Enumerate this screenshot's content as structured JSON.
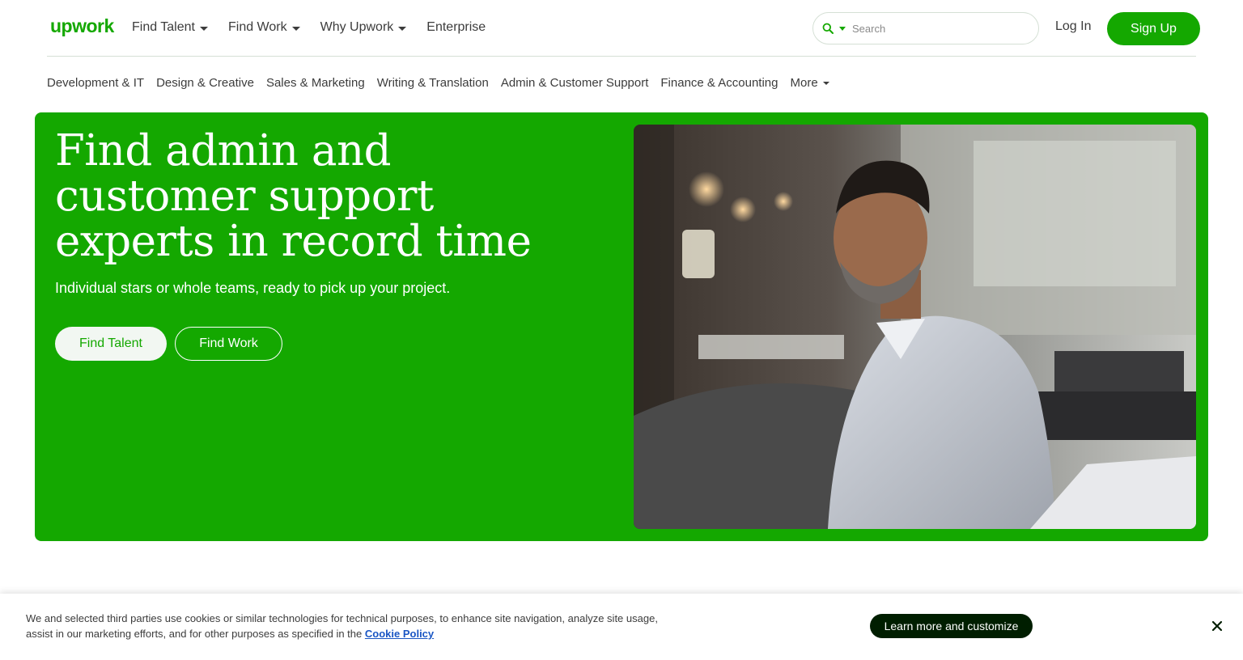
{
  "brand": {
    "logo_text": "upwork",
    "accent": "#14a800",
    "dark": "#001e00"
  },
  "header": {
    "nav": [
      {
        "label": "Find Talent",
        "has_caret": true
      },
      {
        "label": "Find Work",
        "has_caret": true
      },
      {
        "label": "Why Upwork",
        "has_caret": true
      },
      {
        "label": "Enterprise",
        "has_caret": false
      }
    ],
    "search": {
      "placeholder": "Search",
      "icon": "search-icon"
    },
    "login_label": "Log In",
    "signup_label": "Sign Up"
  },
  "categories": [
    "Development & IT",
    "Design & Creative",
    "Sales & Marketing",
    "Writing & Translation",
    "Admin & Customer Support",
    "Finance & Accounting",
    "More"
  ],
  "hero": {
    "title": "Find admin and customer support experts in record time",
    "subtitle": "Individual stars or whole teams, ready to pick up your project.",
    "primary_button": "Find Talent",
    "secondary_button": "Find Work",
    "photo": "man-working-at-laptop-in-office"
  },
  "cookie_banner": {
    "text": "We and selected third parties use cookies or similar technologies for technical purposes, to enhance site navigation, analyze site usage, assist in our marketing efforts, and for other purposes as specified in the",
    "link_label": "Cookie Policy",
    "button_label": "Learn more and customize",
    "close_icon": "close-icon"
  }
}
